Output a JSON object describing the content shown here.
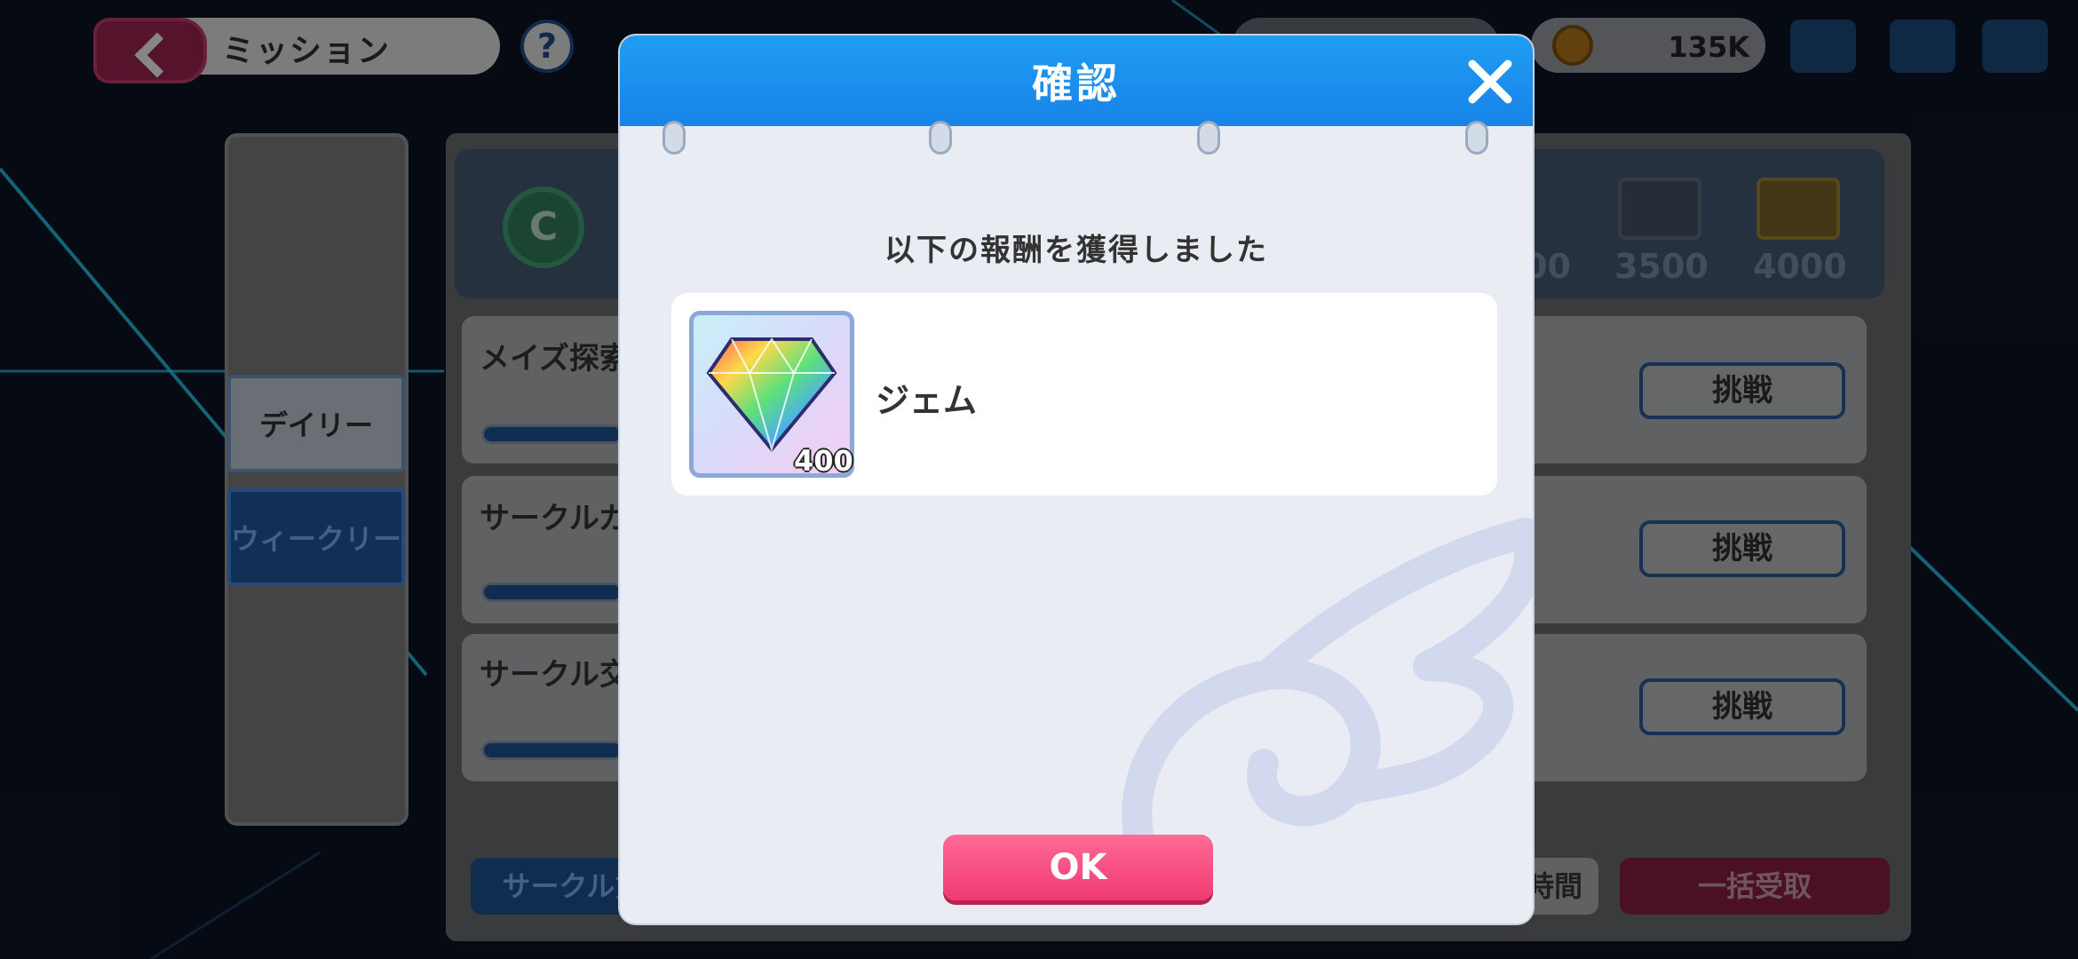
{
  "header": {
    "title": "ミッション",
    "help_glyph": "?",
    "coins": "135K"
  },
  "tabs": {
    "daily": "デイリー",
    "weekly": "ウィークリー"
  },
  "progress": {
    "badge": "C",
    "milestones": [
      "00",
      "3500",
      "4000"
    ]
  },
  "missions": [
    {
      "title": "メイズ探索",
      "button": "挑戦",
      "progress": 0.7
    },
    {
      "title": "サークルガ",
      "button": "挑戦",
      "progress": 0.5
    },
    {
      "title": "サークル交",
      "button": "挑戦",
      "progress": 0.7
    }
  ],
  "bottom": {
    "left_button": "サークル貢",
    "time_button": "時間",
    "claim_all": "一括受取"
  },
  "dialog": {
    "title": "確認",
    "message": "以下の報酬を獲得しました",
    "reward": {
      "name": "ジェム",
      "quantity": "400",
      "icon": "rainbow-gem-icon"
    },
    "ok_label": "OK"
  },
  "colors": {
    "header_blue": "#1783e8",
    "ok_pink": "#f03a74",
    "dialog_bg": "#e9edf3"
  }
}
